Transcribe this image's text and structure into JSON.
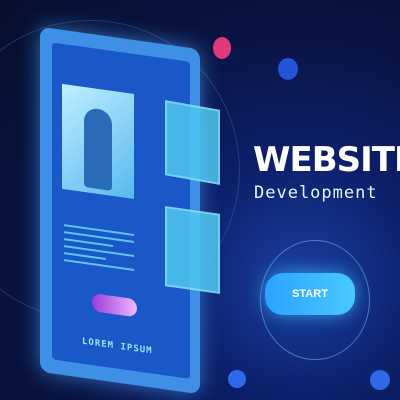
{
  "hero": {
    "title": "WEBSITE",
    "subtitle": "Development",
    "start_label": "START"
  },
  "illustration": {
    "tablet_text": "LOREM IPSUM"
  },
  "colors": {
    "accent": "#2aa4ff",
    "background": "#0a1444",
    "pink": "#e03a7a",
    "purple": "#9a3bd8"
  }
}
